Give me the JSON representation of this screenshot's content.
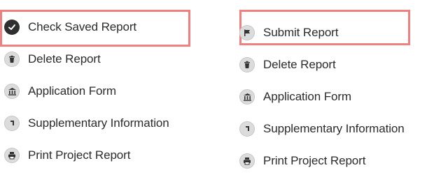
{
  "left_menu": {
    "items": [
      {
        "label": "Check Saved Report",
        "icon": "check-circle-icon"
      },
      {
        "label": "Delete Report",
        "icon": "trash-icon"
      },
      {
        "label": "Application Form",
        "icon": "building-icon"
      },
      {
        "label": "Supplementary Information",
        "icon": "corner-arrow-icon"
      },
      {
        "label": "Print Project Report",
        "icon": "printer-icon"
      }
    ]
  },
  "right_menu": {
    "items": [
      {
        "label": "Submit Report",
        "icon": "flag-icon"
      },
      {
        "label": "Delete Report",
        "icon": "trash-icon"
      },
      {
        "label": "Application Form",
        "icon": "building-icon"
      },
      {
        "label": "Supplementary Information",
        "icon": "corner-arrow-icon"
      },
      {
        "label": "Print Project Report",
        "icon": "printer-icon"
      }
    ]
  },
  "colors": {
    "highlight": "#f08080",
    "icon_bg": "#dcdcdc",
    "icon_dark": "#2f2f2f",
    "text": "#2b2b2b"
  }
}
